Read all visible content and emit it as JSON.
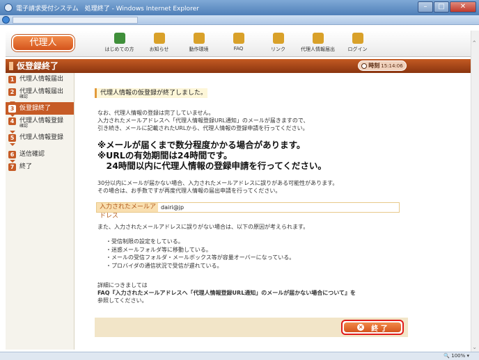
{
  "window": {
    "title": "電子請求受付システム　処理終了 - Windows Internet Explorer",
    "controls": [
      "–",
      "□",
      "✕"
    ]
  },
  "header": {
    "agent_label": "代理人",
    "nav": [
      {
        "label": "はじめての方",
        "icon": "beginner-icon",
        "color": "#3f8f3a"
      },
      {
        "label": "お知らせ",
        "icon": "info-icon",
        "color": "#d9a12a"
      },
      {
        "label": "動作環境",
        "icon": "monitor-icon",
        "color": "#d9a12a"
      },
      {
        "label": "FAQ",
        "icon": "faq-icon",
        "color": "#d9a12a"
      },
      {
        "label": "リンク",
        "icon": "link-icon",
        "color": "#d9a12a"
      },
      {
        "label": "代理人情報届出",
        "icon": "agent-register-icon",
        "color": "#d9a12a"
      },
      {
        "label": "ログイン",
        "icon": "login-icon",
        "color": "#d9a12a"
      }
    ]
  },
  "stepbar": {
    "title": "仮登録終了",
    "clock_label": "時刻",
    "clock_value": "15:14:06"
  },
  "sidebar": {
    "items": [
      {
        "num": "1",
        "label": "代理人情報届出",
        "sub": "",
        "active": false
      },
      {
        "num": "2",
        "label": "代理人情報届出",
        "sub": "確認",
        "active": false
      },
      {
        "num": "3",
        "label": "仮登録終了",
        "sub": "",
        "active": true
      },
      {
        "num": "4",
        "label": "代理人情報登録",
        "sub": "確認",
        "active": false
      },
      {
        "num": "5",
        "label": "代理人情報登録",
        "sub": "",
        "active": false
      },
      {
        "num": "6",
        "label": "送信確認",
        "sub": "",
        "active": false
      },
      {
        "num": "7",
        "label": "終了",
        "sub": "",
        "active": false
      }
    ]
  },
  "content": {
    "notice": "代理人情報の仮登録が終了しました。",
    "para1": [
      "なお、代理人情報の登録は完了していません。",
      "入力されたメールアドレスへ「代理人情報登録URL通知」のメールが届きますので、",
      "引き続き、メールに記載されたURLから、代理人情報の登録申請を行ってください。"
    ],
    "warnings": [
      "※メールが届くまで数分程度かかる場合があります。",
      "※URLの有効期間は24時間です。",
      "　24時間以内に代理人情報の登録申請を行ってください。"
    ],
    "para2": [
      "30分以内にメールが届かない場合、入力されたメールアドレスに誤りがある可能性があります。",
      "その場合は、お手数ですが再度代理人情報の届出申請を行ってください。"
    ],
    "email_label": "入力されたメールアドレス",
    "email_value": "dairi@jp",
    "para3": "また、入力されたメールアドレスに誤りがない場合は、以下の原因が考えられます。",
    "reasons": [
      "・受信制限の設定をしている。",
      "・迷惑メールフォルダ等に移動している。",
      "・メールの受信フォルダ・メールボックス等が容量オーバーになっている。",
      "・プロバイダの通信状況で受信が遅れている。"
    ],
    "detail": [
      "詳細につきましては",
      "FAQ『入力されたメールアドレスへ「代理人情報登録URL通知」のメールが届かない場合について』を",
      "参照してください。"
    ],
    "finish_label": "終 了"
  },
  "status": {
    "zoom": "100%"
  }
}
